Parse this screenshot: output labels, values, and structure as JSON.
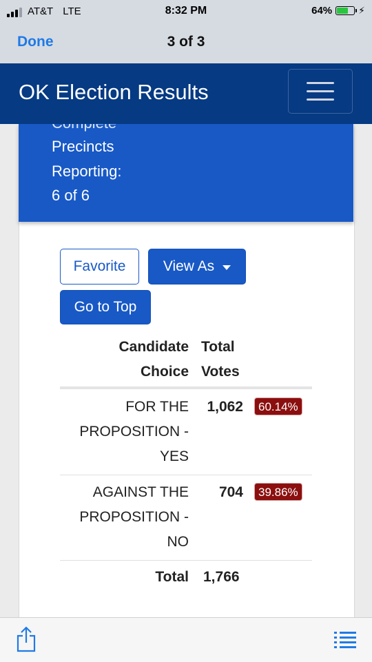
{
  "status_bar": {
    "carrier": "AT&T",
    "network": "LTE",
    "time": "8:32 PM",
    "battery": "64%",
    "battery_level": 0.64
  },
  "viewer": {
    "done_label": "Done",
    "pager": "3 of 3"
  },
  "navbar": {
    "brand": "OK Election Results"
  },
  "status_panel": {
    "cut_text": "Complete",
    "line1": "Precincts",
    "line2": "Reporting:",
    "line3": "6 of 6"
  },
  "buttons": {
    "favorite": "Favorite",
    "view_as": "View As",
    "go_to_top": "Go to Top"
  },
  "table": {
    "header_choice_1": "Candidate",
    "header_choice_2": "Choice",
    "header_votes_1": "Total",
    "header_votes_2": "Votes",
    "rows": [
      {
        "choice_1": "FOR THE",
        "choice_2": "PROPOSITION -",
        "choice_3": "YES",
        "votes": "1,062",
        "percent": "60.14%"
      },
      {
        "choice_1": "AGAINST THE",
        "choice_2": "PROPOSITION -",
        "choice_3": "NO",
        "votes": "704",
        "percent": "39.86%"
      }
    ],
    "total_label": "Total",
    "total_votes": "1,766"
  },
  "colors": {
    "navbar": "#063a83",
    "panel": "#1859c6",
    "badge": "#8b0f0f",
    "ios_link": "#1f7ae6"
  },
  "toolbar": {
    "share_icon": "share-icon",
    "list_icon": "list-icon"
  }
}
